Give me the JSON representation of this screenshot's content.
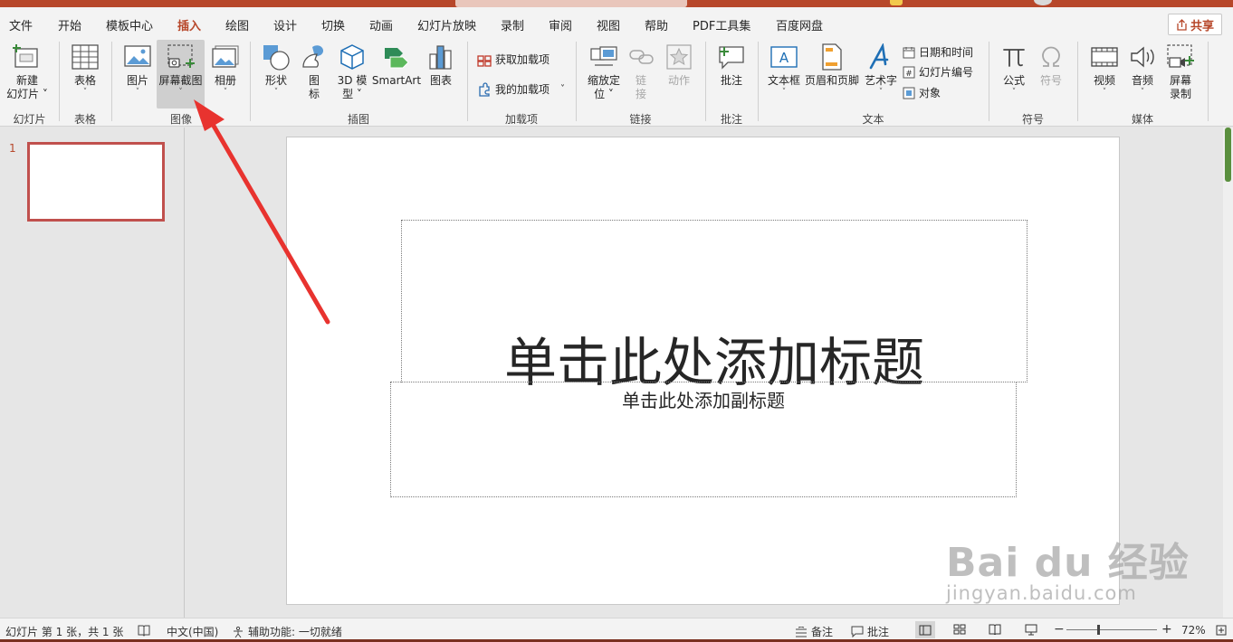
{
  "colors": {
    "accent": "#b7472a",
    "thumb_border": "#c0504d",
    "ribbon_bg": "#f3f3f3"
  },
  "tabs": [
    {
      "label": "文件",
      "active": false
    },
    {
      "label": "开始",
      "active": false
    },
    {
      "label": "模板中心",
      "active": false
    },
    {
      "label": "插入",
      "active": true
    },
    {
      "label": "绘图",
      "active": false
    },
    {
      "label": "设计",
      "active": false
    },
    {
      "label": "切换",
      "active": false
    },
    {
      "label": "动画",
      "active": false
    },
    {
      "label": "幻灯片放映",
      "active": false
    },
    {
      "label": "录制",
      "active": false
    },
    {
      "label": "审阅",
      "active": false
    },
    {
      "label": "视图",
      "active": false
    },
    {
      "label": "帮助",
      "active": false
    },
    {
      "label": "PDF工具集",
      "active": false
    },
    {
      "label": "百度网盘",
      "active": false
    }
  ],
  "share_label": "共享",
  "ribbon": {
    "new_slide": {
      "line1": "新建",
      "line2": "幻灯片"
    },
    "table": "表格",
    "picture": "图片",
    "screenshot": "屏幕截图",
    "album": "相册",
    "shapes": "形状",
    "icons": {
      "line1": "图",
      "line2": "标"
    },
    "model3d": {
      "line1": "3D 模",
      "line2": "型"
    },
    "smartart": "SmartArt",
    "chart": "图表",
    "get_addins": "获取加载项",
    "my_addins": "我的加载项",
    "zoom": {
      "line1": "缩放定",
      "line2": "位"
    },
    "link": {
      "line1": "链",
      "line2": "接"
    },
    "action": "动作",
    "comment": "批注",
    "textbox": "文本框",
    "header_footer": "页眉和页脚",
    "wordart": "艺术字",
    "date_time": "日期和时间",
    "slide_number": "幻灯片编号",
    "object": "对象",
    "equation": "公式",
    "symbol": "符号",
    "video": "视频",
    "audio": "音频",
    "screen_record": {
      "line1": "屏幕",
      "line2": "录制"
    },
    "groups": {
      "slides": "幻灯片",
      "tables": "表格",
      "images": "图像",
      "illustrations": "插图",
      "addins": "加载项",
      "links": "链接",
      "comments": "批注",
      "text": "文本",
      "symbols": "符号",
      "media": "媒体"
    }
  },
  "thumbnails": [
    {
      "number": "1"
    }
  ],
  "slide": {
    "title_placeholder": "单击此处添加标题",
    "subtitle_placeholder": "单击此处添加副标题"
  },
  "status": {
    "slide_info": "幻灯片 第 1 张，共 1 张",
    "language": "中文(中国)",
    "accessibility": "辅助功能: 一切就绪",
    "notes": "备注",
    "comments": "批注",
    "zoom_minus": "−",
    "zoom_plus": "+",
    "zoom_level": "72%"
  },
  "watermark": {
    "brand": "Bai  du 经验",
    "url": "jingyan.baidu.com"
  }
}
